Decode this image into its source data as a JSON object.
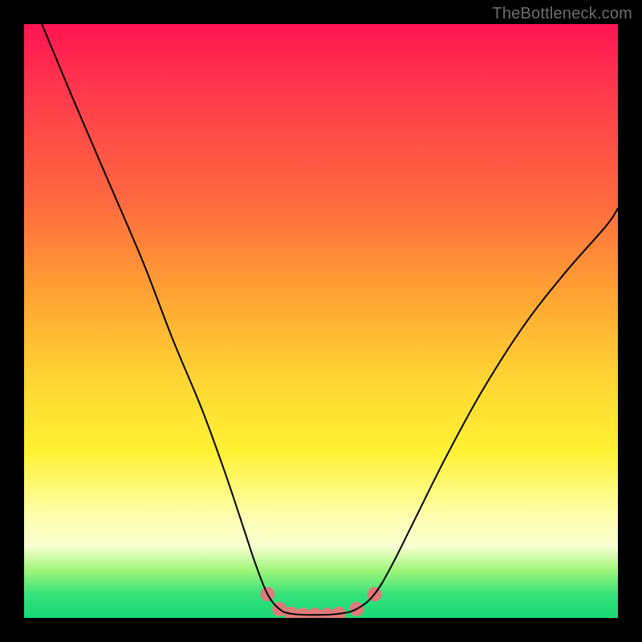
{
  "attribution": "TheBottleneck.com",
  "chart_data": {
    "type": "line",
    "title": "",
    "xlabel": "",
    "ylabel": "",
    "xlim": [
      0,
      100
    ],
    "ylim": [
      0,
      100
    ],
    "grid": false,
    "legend": false,
    "series": [
      {
        "name": "curve",
        "x": [
          3,
          8,
          14,
          20,
          25,
          30,
          34,
          37,
          39,
          41,
          43,
          45,
          49,
          53,
          56,
          59,
          62,
          66,
          71,
          77,
          84,
          91,
          98,
          100
        ],
        "y": [
          100,
          88,
          74,
          60,
          47,
          35,
          24,
          15,
          9,
          4,
          1.5,
          0.7,
          0.5,
          0.7,
          1.5,
          4,
          9,
          17,
          27,
          38,
          49,
          58,
          66,
          69
        ],
        "color": "#000000",
        "linewidth": 2
      }
    ],
    "highlights": [
      {
        "x": 41,
        "y": 4,
        "color": "#e07a7a",
        "r": 9
      },
      {
        "x": 43,
        "y": 1.5,
        "color": "#e07a7a",
        "r": 9
      },
      {
        "x": 45,
        "y": 0.7,
        "color": "#e07a7a",
        "r": 9
      },
      {
        "x": 47,
        "y": 0.5,
        "color": "#e07a7a",
        "r": 9
      },
      {
        "x": 49,
        "y": 0.5,
        "color": "#e07a7a",
        "r": 9
      },
      {
        "x": 51,
        "y": 0.5,
        "color": "#e07a7a",
        "r": 9
      },
      {
        "x": 53,
        "y": 0.7,
        "color": "#e07a7a",
        "r": 9
      },
      {
        "x": 56,
        "y": 1.5,
        "color": "#e07a7a",
        "r": 9
      },
      {
        "x": 59,
        "y": 4,
        "color": "#e07a7a",
        "r": 9
      }
    ],
    "background_gradient": {
      "type": "vertical",
      "stops": [
        {
          "pos": 0.0,
          "color": "#ff1452"
        },
        {
          "pos": 0.12,
          "color": "#ff3b4c"
        },
        {
          "pos": 0.3,
          "color": "#ff6a3f"
        },
        {
          "pos": 0.45,
          "color": "#ffa133"
        },
        {
          "pos": 0.6,
          "color": "#ffd633"
        },
        {
          "pos": 0.72,
          "color": "#fff233"
        },
        {
          "pos": 0.83,
          "color": "#ffffb0"
        },
        {
          "pos": 0.88,
          "color": "#f6ffd0"
        },
        {
          "pos": 0.92,
          "color": "#9ff57a"
        },
        {
          "pos": 0.96,
          "color": "#38e27a"
        },
        {
          "pos": 1.0,
          "color": "#16d977"
        }
      ]
    }
  }
}
